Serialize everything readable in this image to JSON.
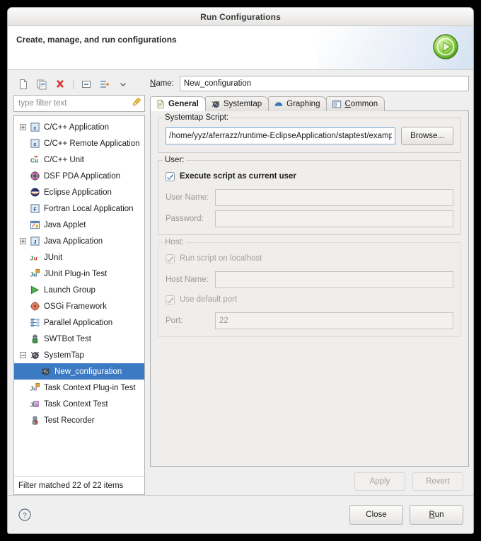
{
  "window": {
    "title": "Run Configurations"
  },
  "banner": {
    "title": "Create, manage, and run configurations",
    "icon": "run-launch-icon"
  },
  "left_panel": {
    "toolbar": [
      {
        "name": "new-configuration-icon",
        "label": "New launch configuration"
      },
      {
        "name": "duplicate-configuration-icon",
        "label": "Duplicate launch configuration"
      },
      {
        "name": "delete-configuration-icon",
        "label": "Delete selected launch configuration"
      },
      {
        "name": "collapse-all-icon",
        "label": "Collapse All"
      },
      {
        "name": "filter-configurations-icon",
        "label": "Filter launch configurations"
      },
      {
        "name": "view-menu-chevron-icon",
        "label": "View Menu"
      }
    ],
    "filter": {
      "placeholder": "type filter text",
      "value": "",
      "clear_icon": "clear-filter-broom-icon"
    },
    "tree": [
      {
        "label": "C/C++ Application",
        "icon": "c-application-icon",
        "twisty": "plus",
        "indent": 0,
        "selected": false
      },
      {
        "label": "C/C++ Remote Application",
        "icon": "c-application-icon",
        "twisty": "none",
        "indent": 1,
        "selected": false
      },
      {
        "label": "C/C++ Unit",
        "icon": "cunit-icon",
        "twisty": "none",
        "indent": 1,
        "selected": false
      },
      {
        "label": "DSF PDA Application",
        "icon": "dsf-pda-icon",
        "twisty": "none",
        "indent": 1,
        "selected": false
      },
      {
        "label": "Eclipse Application",
        "icon": "eclipse-icon",
        "twisty": "none",
        "indent": 1,
        "selected": false
      },
      {
        "label": "Fortran Local Application",
        "icon": "fortran-icon",
        "twisty": "none",
        "indent": 1,
        "selected": false
      },
      {
        "label": "Java Applet",
        "icon": "java-applet-icon",
        "twisty": "none",
        "indent": 1,
        "selected": false
      },
      {
        "label": "Java Application",
        "icon": "java-application-icon",
        "twisty": "plus",
        "indent": 0,
        "selected": false
      },
      {
        "label": "JUnit",
        "icon": "junit-icon",
        "twisty": "none",
        "indent": 1,
        "selected": false
      },
      {
        "label": "JUnit Plug-in Test",
        "icon": "junit-plugin-icon",
        "twisty": "none",
        "indent": 1,
        "selected": false
      },
      {
        "label": "Launch Group",
        "icon": "launch-group-icon",
        "twisty": "none",
        "indent": 1,
        "selected": false
      },
      {
        "label": "OSGi Framework",
        "icon": "osgi-icon",
        "twisty": "none",
        "indent": 1,
        "selected": false
      },
      {
        "label": "Parallel Application",
        "icon": "parallel-application-icon",
        "twisty": "none",
        "indent": 1,
        "selected": false
      },
      {
        "label": "SWTBot Test",
        "icon": "swtbot-icon",
        "twisty": "none",
        "indent": 1,
        "selected": false
      },
      {
        "label": "SystemTap",
        "icon": "systemtap-icon",
        "twisty": "minus",
        "indent": 0,
        "selected": false
      },
      {
        "label": "New_configuration",
        "icon": "systemtap-icon",
        "twisty": "none",
        "indent": 2,
        "selected": true
      },
      {
        "label": "Task Context Plug-in Test",
        "icon": "task-context-plugin-icon",
        "twisty": "none",
        "indent": 1,
        "selected": false
      },
      {
        "label": "Task Context Test",
        "icon": "task-context-icon",
        "twisty": "none",
        "indent": 1,
        "selected": false
      },
      {
        "label": "Test Recorder",
        "icon": "test-recorder-icon",
        "twisty": "none",
        "indent": 1,
        "selected": false
      }
    ],
    "status": "Filter matched 22 of 22 items"
  },
  "right_panel": {
    "name_label": "Name:",
    "name_label_mnemonic": "N",
    "name_value": "New_configuration",
    "tabs": [
      {
        "label": "General",
        "icon": "general-document-icon",
        "active": true
      },
      {
        "label": "Systemtap",
        "icon": "systemtap-icon",
        "active": false
      },
      {
        "label": "Graphing",
        "icon": "graphing-icon",
        "active": false
      },
      {
        "label": "Common",
        "icon": "common-window-icon",
        "active": false,
        "mnemonic": "C"
      }
    ],
    "script_group": {
      "legend": "Systemtap Script:",
      "value": "/home/yyz/aferrazz/runtime-EclipseApplication/staptest/example.st",
      "browse_label": "Browse..."
    },
    "user_group": {
      "legend": "User:",
      "checkbox_label": "Execute script as current user",
      "checkbox_checked": true,
      "checkbox_enabled": true,
      "fields": [
        {
          "label": "User Name:",
          "value": "",
          "enabled": false
        },
        {
          "label": "Password:",
          "value": "",
          "enabled": false
        }
      ]
    },
    "host_group": {
      "legend": "Host:",
      "enabled": false,
      "localhost_checkbox_label": "Run script on localhost",
      "localhost_checked": true,
      "host_name_label": "Host Name:",
      "host_name_value": "",
      "default_port_checkbox_label": "Use default port",
      "default_port_checked": true,
      "port_label": "Port:",
      "port_value": "22"
    },
    "apply_label": "Apply",
    "apply_enabled": false,
    "revert_label": "Revert",
    "revert_enabled": false
  },
  "footer": {
    "help_icon": "help-question-icon",
    "close_label": "Close",
    "run_label": "Run",
    "run_mnemonic": "R"
  },
  "colors": {
    "selection_blue": "#3c7ac4",
    "window_bg": "#f0eff0",
    "field_focus_border": "#7aa7d8",
    "run_green": "#5cb536"
  }
}
